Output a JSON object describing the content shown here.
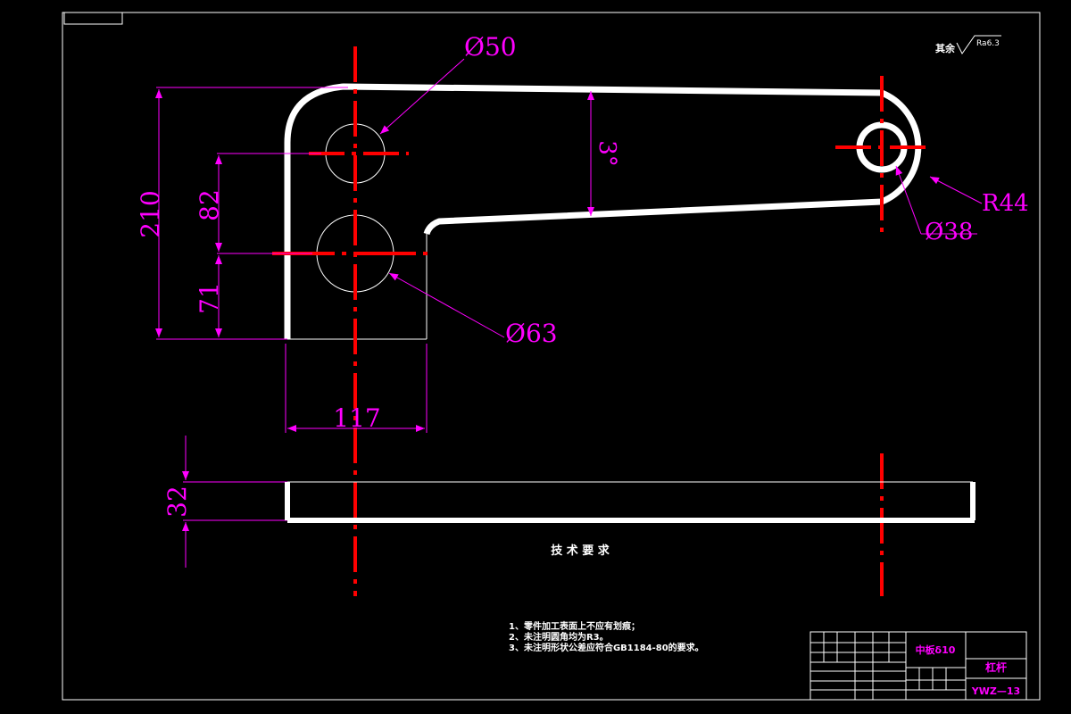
{
  "surface_finish": {
    "prefix": "其余",
    "value": "Ra6.3"
  },
  "dimensions": {
    "bore_upper": "Ø50",
    "bore_lower": "Ø63",
    "bore_small": "Ø38",
    "outer_radius": "R44",
    "angle": "3°",
    "total_height": "210",
    "upper_height": "82",
    "lower_height": "71",
    "hub_width": "117",
    "thickness": "32"
  },
  "technical_requirements": {
    "heading": "技 术 要 求",
    "items": [
      "1、零件加工表面上不应有划痕；",
      "2、未注明圆角均为R3。",
      "3、未注明形状公差应符合GB1184-80的要求。"
    ]
  },
  "title_block": {
    "material": "中板δ10",
    "part_name": "杠杆",
    "drawing_number": "YWZ—13"
  },
  "colors": {
    "background": "#000000",
    "outline": "#ffffff",
    "centerline": "#ff0000",
    "dimension": "#ff00ff"
  }
}
